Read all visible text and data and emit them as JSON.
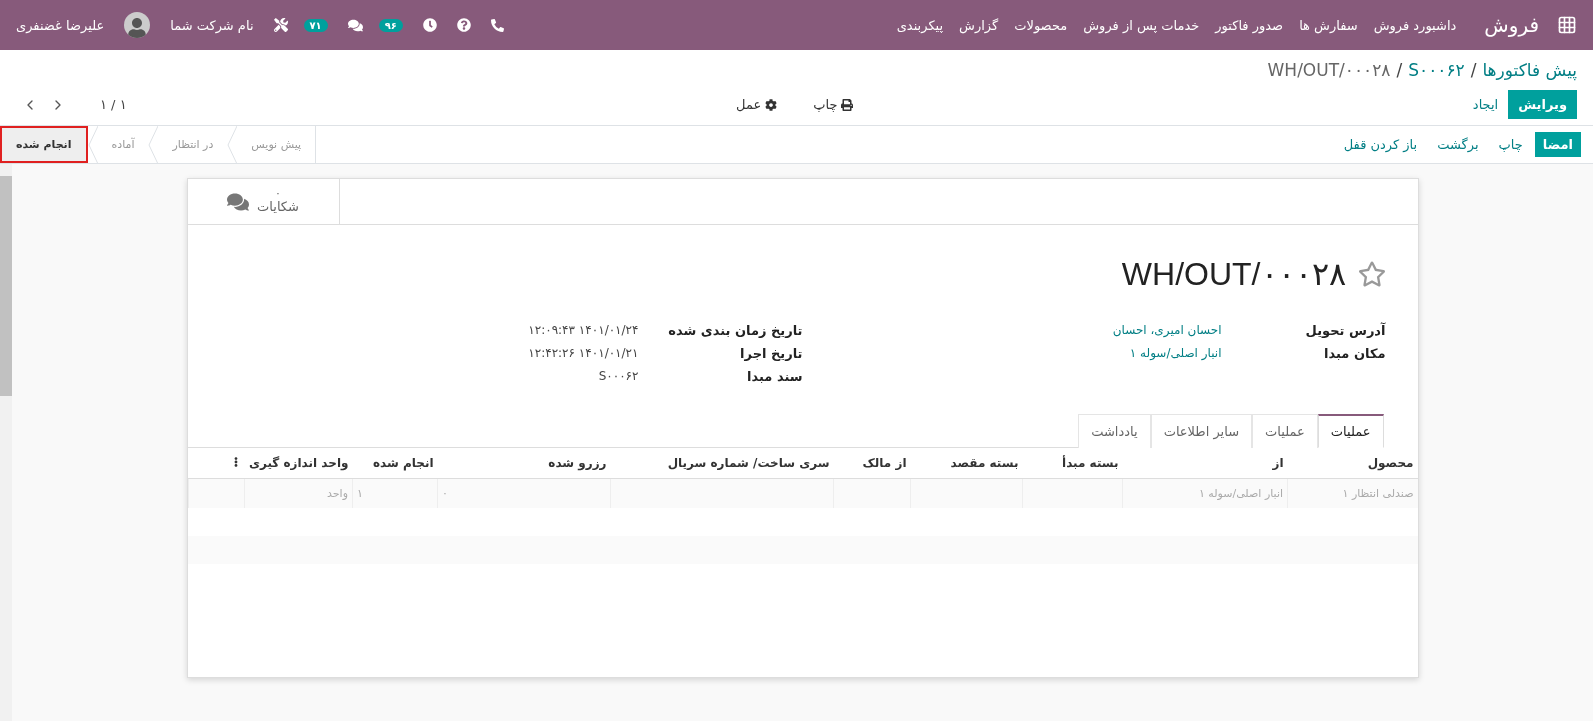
{
  "navbar": {
    "brand": "فروش",
    "menu": [
      "داشبورد فروش",
      "سفارش ها",
      "صدور فاکتور",
      "خدمات پس از فروش",
      "محصولات",
      "گزارش",
      "پیکربندی"
    ],
    "activity_count": "۹۶",
    "message_count": "۷۱",
    "company": "نام شرکت شما",
    "user": "علیرضا غضنفری"
  },
  "breadcrumb": {
    "separator": "/",
    "items": [
      "پیش فاکتورها",
      "S۰۰۰۶۲",
      "WH/OUT/۰۰۰۲۸"
    ]
  },
  "control_panel": {
    "edit": "ویرایش",
    "create": "ایجاد",
    "print": "چاپ",
    "action": "عمل",
    "pager": "۱ / ۱"
  },
  "status_bar": {
    "buttons": [
      {
        "label": "امضا",
        "primary": true
      },
      {
        "label": "چاپ",
        "primary": false
      },
      {
        "label": "برگشت",
        "primary": false
      },
      {
        "label": "باز کردن قفل",
        "primary": false
      }
    ],
    "stages": [
      {
        "label": "پیش نویس",
        "selected": false
      },
      {
        "label": "در انتظار",
        "selected": false
      },
      {
        "label": "آماده",
        "selected": false
      },
      {
        "label": "انجام شده",
        "selected": true
      }
    ]
  },
  "smart_button": {
    "count": "۰",
    "label": "شکایات"
  },
  "title": "WH/OUT/۰۰۰۲۸",
  "starred": false,
  "fields_right": [
    {
      "label": "آدرس تحویل",
      "value": "احسان امیری، احسان",
      "link": true
    },
    {
      "label": "مکان مبدا",
      "value": "انبار اصلی/سوله ۱",
      "link": true
    }
  ],
  "fields_left": [
    {
      "label": "تاریخ زمان بندی شده",
      "value": "۱۴۰۱/۰۱/۲۴ ۱۲:۰۹:۴۳",
      "link": false
    },
    {
      "label": "تاریخ اجرا",
      "value": "۱۴۰۱/۰۱/۲۱ ۱۲:۴۲:۲۶",
      "link": false
    },
    {
      "label": "سند مبدا",
      "value": "S۰۰۰۶۲",
      "link": false
    }
  ],
  "tabs": [
    {
      "label": "عملیات",
      "selected": true
    },
    {
      "label": "عملیات",
      "selected": false
    },
    {
      "label": "سایر اطلاعات",
      "selected": false
    },
    {
      "label": "یادداشت",
      "selected": false
    }
  ],
  "table": {
    "columns": [
      "محصول",
      "از",
      "بسته مبدأ",
      "بسته مقصد",
      "از مالک",
      "سری ساخت/ شماره سریال",
      "رزرو شده",
      "انجام شده",
      "واحد اندازه گیری"
    ],
    "rows": [
      {
        "cells": [
          "صندلی انتظار ۱",
          "انبار اصلی/سوله ۱",
          "",
          "",
          "",
          "",
          "۰",
          "۱",
          "واحد"
        ]
      }
    ]
  }
}
